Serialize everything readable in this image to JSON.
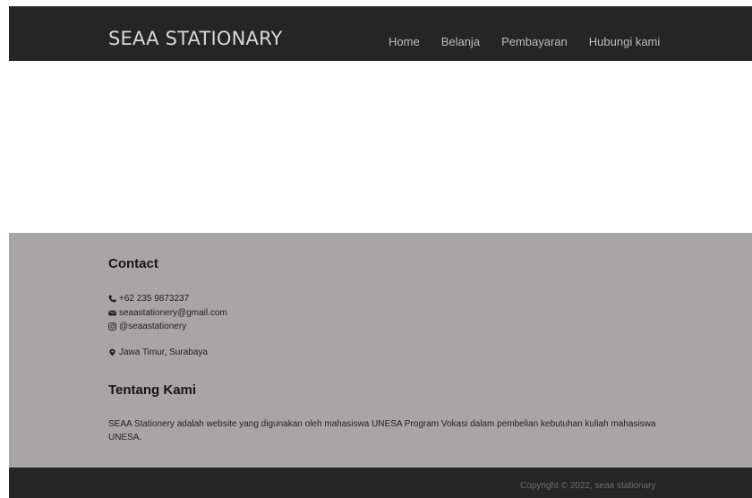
{
  "navbar": {
    "brand": "SEAA STATIONARY",
    "links": [
      "Home",
      "Belanja",
      "Pembayaran",
      "Hubungi kami"
    ]
  },
  "contact": {
    "title": "Contact",
    "phone": "+62 235 9873237",
    "email": "seaastationery@gmail.com",
    "instagram": "@seaastationery",
    "location": "Jawa Timur, Surabaya"
  },
  "about": {
    "title": "Tentang Kami",
    "text": "SEAA Stationery adalah website yang digunakan oleh mahasiswa UNESA Program Vokasi dalam pembelian kebutuhan kuliah mahasiswa UNESA."
  },
  "footer": {
    "copyright": "Copyright © 2022, seaa stationary"
  },
  "colors": {
    "navbar_bg": "#252525",
    "info_bg": "#a7a5a6",
    "footer_bg": "#252525"
  },
  "icons": {
    "phone": "phone-icon",
    "email": "envelope-icon",
    "instagram": "instagram-icon",
    "location": "map-marker-icon"
  }
}
